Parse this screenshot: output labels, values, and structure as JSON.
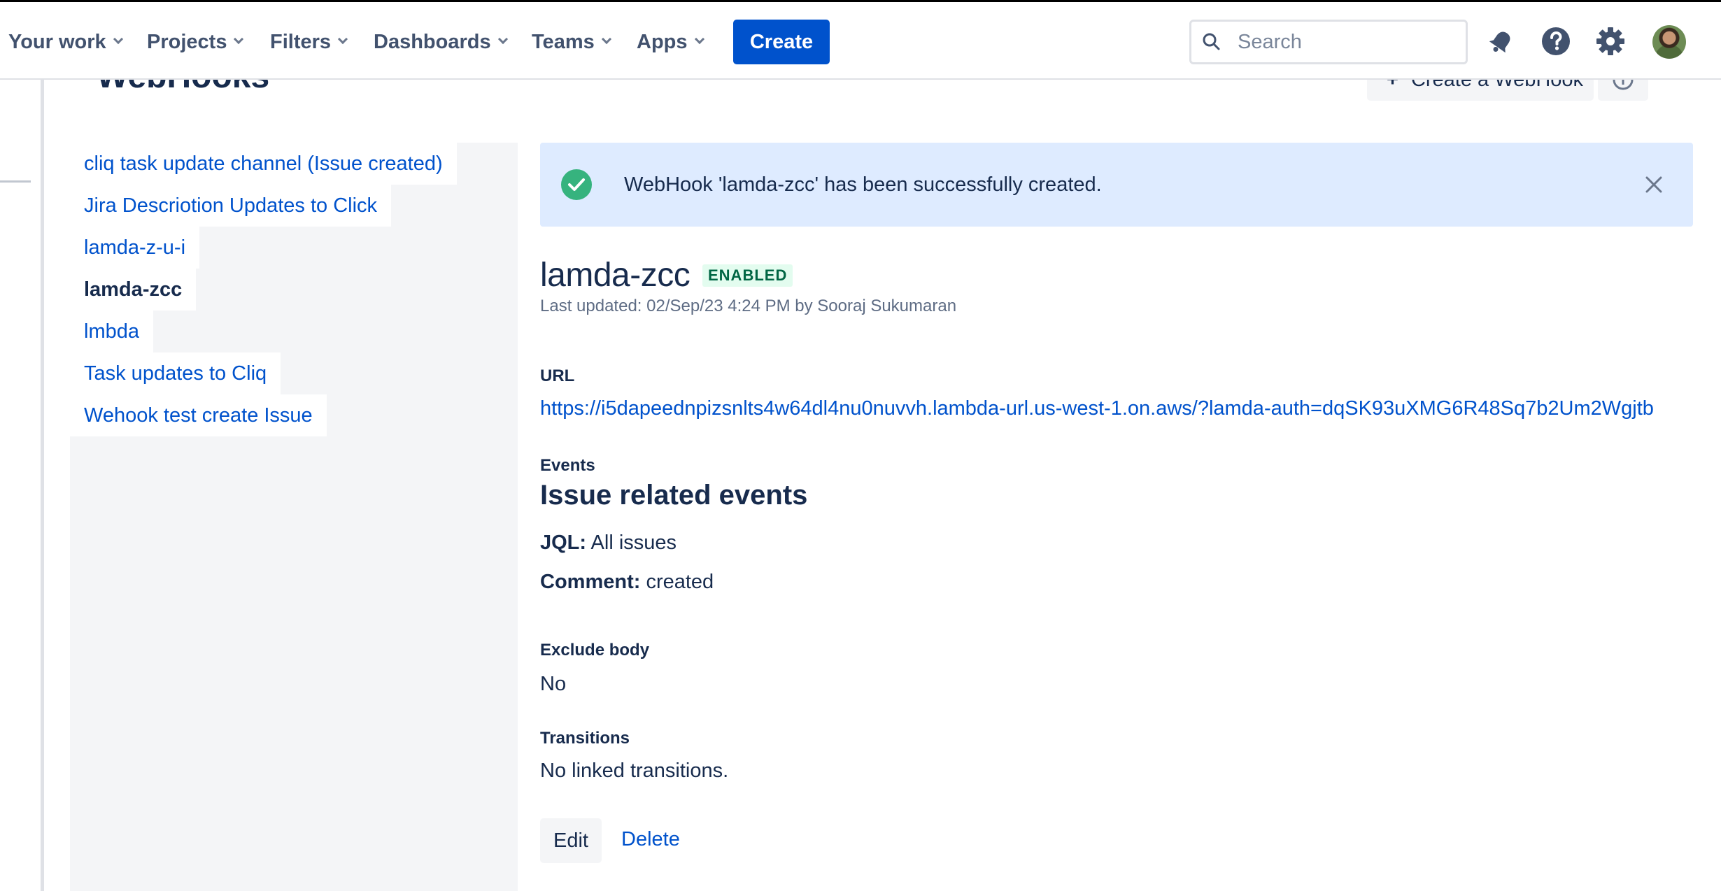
{
  "nav": {
    "items": [
      {
        "label": "Your work"
      },
      {
        "label": "Projects"
      },
      {
        "label": "Filters"
      },
      {
        "label": "Dashboards"
      },
      {
        "label": "Teams"
      },
      {
        "label": "Apps"
      }
    ],
    "create_label": "Create",
    "search_placeholder": "Search",
    "icons": [
      "notifications-icon",
      "help-icon",
      "settings-icon",
      "avatar"
    ]
  },
  "page": {
    "title": "WebHooks",
    "create_webhook_label": "Create a WebHook"
  },
  "sidebar": {
    "items": [
      {
        "label": "cliq task update channel (Issue created)",
        "active": false
      },
      {
        "label": "Jira Descriotion Updates to Click",
        "active": false
      },
      {
        "label": "lamda-z-u-i",
        "active": false
      },
      {
        "label": "lamda-zcc",
        "active": true
      },
      {
        "label": "lmbda",
        "active": false
      },
      {
        "label": "Task updates to Cliq",
        "active": false
      },
      {
        "label": "Wehook test create Issue",
        "active": false
      }
    ]
  },
  "banner": {
    "message": "WebHook 'lamda-zcc' has been successfully created."
  },
  "webhook": {
    "name": "lamda-zcc",
    "status": "ENABLED",
    "last_updated": "Last updated: 02/Sep/23 4:24 PM by Sooraj Sukumaran",
    "url_label": "URL",
    "url": "https://i5dapeednpizsnlts4w64dl4nu0nuvvh.lambda-url.us-west-1.on.aws/?lamda-auth=dqSK93uXMG6R48Sq7b2Um2Wgjtb",
    "events_label": "Events",
    "events_heading": "Issue related events",
    "jql_key": "JQL:",
    "jql_value": "All issues",
    "comment_key": "Comment:",
    "comment_value": "created",
    "exclude_body_label": "Exclude body",
    "exclude_body_value": "No",
    "transitions_label": "Transitions",
    "transitions_value": "No linked transitions."
  },
  "actions": {
    "edit_label": "Edit",
    "delete_label": "Delete"
  },
  "colors": {
    "brand": "#0052cc",
    "link": "#0052cc",
    "banner_bg": "#deebff",
    "success": "#36b37e",
    "enabled_bg": "#e3fcef",
    "enabled_text": "#006644",
    "sidebar_bg": "#f4f5f7"
  }
}
